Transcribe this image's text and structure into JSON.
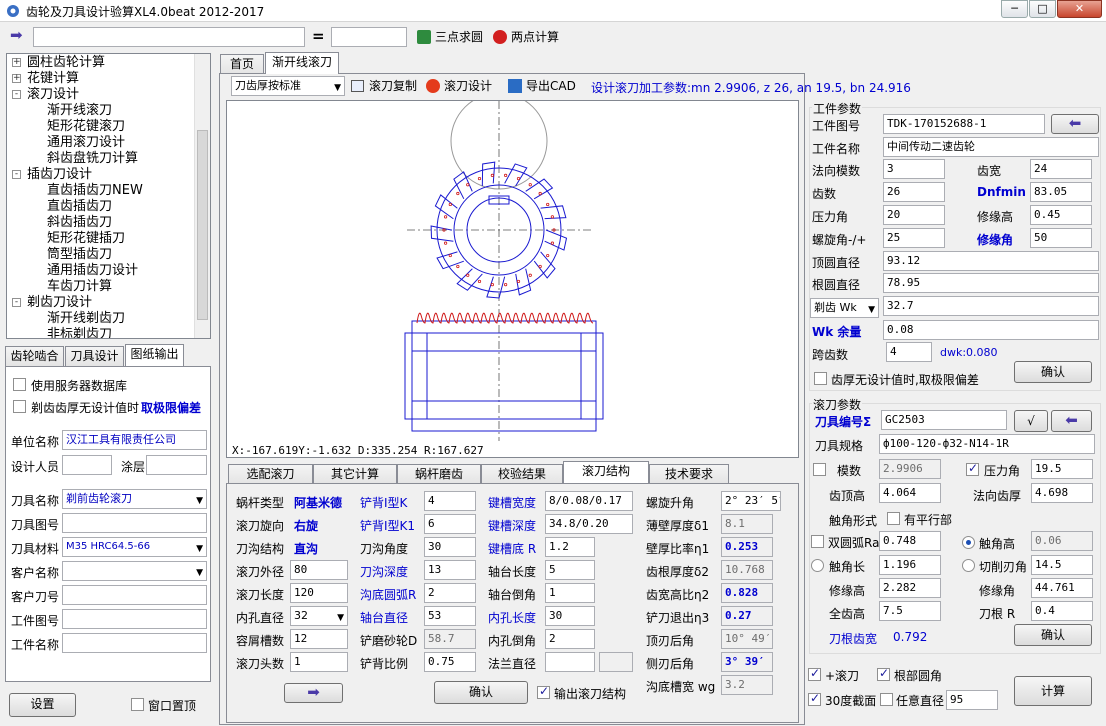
{
  "window": {
    "title": "齿轮及刀具设计验算XL4.0beat  2012-2017",
    "min": "─",
    "max": "□",
    "close": "✕"
  },
  "toolbar": {
    "input_value": "",
    "equals": "=",
    "result_value": "",
    "three_point": "三点求圆",
    "two_point": "两点计算"
  },
  "tree": {
    "items": [
      {
        "label": "圆柱齿轮计算",
        "level": 0,
        "pm": "+"
      },
      {
        "label": "花键计算",
        "level": 0,
        "pm": "+"
      },
      {
        "label": "滚刀设计",
        "level": 0,
        "pm": "-"
      },
      {
        "label": "渐开线滚刀",
        "level": 1
      },
      {
        "label": "矩形花键滚刀",
        "level": 1
      },
      {
        "label": "通用滚刀设计",
        "level": 1
      },
      {
        "label": "斜齿盘铣刀计算",
        "level": 1
      },
      {
        "label": "插齿刀设计",
        "level": 0,
        "pm": "-"
      },
      {
        "label": "直齿插齿刀NEW",
        "level": 1
      },
      {
        "label": "直齿插齿刀",
        "level": 1
      },
      {
        "label": "斜齿插齿刀",
        "level": 1
      },
      {
        "label": "矩形花键插刀",
        "level": 1
      },
      {
        "label": "筒型插齿刀",
        "level": 1
      },
      {
        "label": "通用插齿刀设计",
        "level": 1
      },
      {
        "label": "车齿刀计算",
        "level": 1
      },
      {
        "label": "剃齿刀设计",
        "level": 0,
        "pm": "-"
      },
      {
        "label": "渐开线剃齿刀",
        "level": 1
      },
      {
        "label": "非标剃齿刀",
        "level": 1
      }
    ]
  },
  "left_tabs": [
    "齿轮啮合",
    "刀具设计",
    "图纸输出"
  ],
  "left": {
    "use_server": "使用服务器数据库",
    "shave_no_design": "剃齿齿厚无设计值时",
    "limit_dev": "取极限偏差",
    "company_label": "单位名称",
    "company": "汉江工具有限责任公司",
    "designer_label": "设计人员",
    "designer": "",
    "coating_label": "涂层",
    "coating": "",
    "tool_name_label": "刀具名称",
    "tool_name": "剃前齿轮滚刀",
    "tool_drawing_label": "刀具图号",
    "tool_drawing": "",
    "material_label": "刀具材料",
    "material": "M35        HRC64.5-66",
    "customer_label": "客户名称",
    "customer": "",
    "customer_no_label": "客户刀号",
    "customer_no": "",
    "work_drawing_label": "工件图号",
    "work_drawing": "",
    "work_name_label": "工件名称",
    "work_name": "",
    "settings": "设置",
    "window_top": "窗口置顶"
  },
  "main_tabs": [
    "首页",
    "渐开线滚刀"
  ],
  "main_toolbar": {
    "mode": "刀齿厚按标准",
    "copy": "滚刀复制",
    "design": "滚刀设计",
    "export": "导出CAD",
    "params": "设计滚刀加工参数:mn 2.9906, z 26, an 19.5, bn 24.916"
  },
  "canvas": {
    "status": "X:-167.619Y:-1.632  D:335.254 R:167.627"
  },
  "workpiece": {
    "title": "工件参数",
    "drawing_no_label": "工件图号",
    "drawing_no": "TDK-170152688-1",
    "name_label": "工件名称",
    "name": "中间传动二速齿轮",
    "mn_label": "法向模数",
    "mn": "3",
    "width_label": "齿宽",
    "width": "24",
    "z_label": "齿数",
    "z": "26",
    "dnfmin_label": "Dnfmin",
    "dnfmin": "83.05",
    "alpha_label": "压力角",
    "alpha": "20",
    "edge_h_label": "修缘高",
    "edge_h": "0.45",
    "beta_label": "螺旋角-/+",
    "beta": "25",
    "edge_a_label": "修缘角",
    "edge_a": "50",
    "tip_d_label": "顶圆直径",
    "tip_d": "93.12",
    "root_d_label": "根圆直径",
    "root_d": "78.95",
    "wk_select": "剃齿 Wk",
    "wk": "32.7",
    "wk_margin_label": "Wk 余量",
    "wk_margin": "0.08",
    "span_label": "跨齿数",
    "span": "4",
    "dwk": "dwk:0.080",
    "no_design_label": "齿厚无设计值时,取极限偏差",
    "confirm": "确认"
  },
  "hob": {
    "title": "滚刀参数",
    "code_label": "刀具编号Σ",
    "code": "GC2503",
    "check": "√",
    "spec_label": "刀具规格",
    "spec": "ф100-120-ф32-N14-1R",
    "mod_label": "模数",
    "mod": "2.9906",
    "pa_label": "压力角",
    "pa": "19.5",
    "tip_h_label": "齿顶高",
    "tip_h": "4.064",
    "ntt_label": "法向齿厚",
    "ntt": "4.698",
    "contact_form_label": "触角形式",
    "parallel_label": "有平行部",
    "double_arc_label": "双圆弧Ra",
    "double_arc": "0.748",
    "contact_h_label": "触角高",
    "contact_h": "0.06",
    "contact_len_label": "触角长",
    "contact_len": "1.196",
    "undercut_label": "切削刃角",
    "undercut": "14.5",
    "edge_hh_label": "修缘高",
    "edge_hh": "2.282",
    "edge_aa_label": "修缘角",
    "edge_aa": "44.761",
    "full_h_label": "全齿高",
    "full_h": "7.5",
    "root_r_label": "刀根 R",
    "root_r": "0.4",
    "root_w_label": "刀根齿宽",
    "root_w": "0.792",
    "confirm": "确认"
  },
  "bottom_opts": {
    "plus_hob": "+滚刀",
    "root_round": "根部圆角",
    "sect30": "30度截面",
    "any_dia": "任意直径",
    "any_dia_val": "95",
    "calc": "计算"
  },
  "struct_tabs": [
    "选配滚刀",
    "其它计算",
    "蜗杆磨齿",
    "校验结果",
    "滚刀结构",
    "技术要求"
  ],
  "struct": {
    "worm_type_label": "蜗杆类型",
    "worm_type": "阿基米德",
    "rot_label": "滚刀旋向",
    "rot": "右旋",
    "groove_label": "刀沟结构",
    "groove": "直沟",
    "od_label": "滚刀外径",
    "od": "80",
    "len_label": "滚刀长度",
    "len": "120",
    "bore_label": "内孔直径",
    "bore": "32",
    "chip_label": "容屑槽数",
    "chip": "12",
    "starts_label": "滚刀头数",
    "starts": "1",
    "k_label": "铲背Ⅰ型K",
    "k": "4",
    "k1_label": "铲背Ⅰ型K1",
    "k1": "6",
    "gangle_label": "刀沟角度",
    "gangle": "30",
    "gdepth_label": "刀沟深度",
    "gdepth": "13",
    "groot_label": "沟底圆弧R",
    "groot": "2",
    "hub_label": "轴台直径",
    "hub": "53",
    "wheel_label": "铲磨砂轮D",
    "wheel": "58.7",
    "ratio_label": "铲背比例",
    "ratio": "0.75",
    "kw_label": "键槽宽度",
    "kw": "8/0.08/0.17",
    "kd_label": "键槽深度",
    "kd": "34.8/0.20",
    "kr_label": "键槽底 R",
    "kr": "1.2",
    "hublen_label": "轴台长度",
    "hublen": "5",
    "hubch_label": "轴台倒角",
    "hubch": "1",
    "borelen_label": "内孔长度",
    "borelen": "30",
    "borech_label": "内孔倒角",
    "borech": "2",
    "flange_label": "法兰直径",
    "flange": "",
    "lead_label": "螺旋升角",
    "lead": "2° 23′ 5″",
    "thin_label": "薄壁厚度δ1",
    "thin": "8.1",
    "wr_label": "壁厚比率η1",
    "wr": "0.253",
    "rt_label": "齿根厚度δ2",
    "rt": "10.768",
    "wr2_label": "齿宽高比η2",
    "wr2": "0.828",
    "rel_label": "铲刀退出η3",
    "rel": "0.27",
    "top_label": "顶刃后角",
    "top": "10° 49′",
    "side_label": "侧刃后角",
    "side": "3° 39′",
    "gw_label": "沟底槽宽 wg",
    "gw": "3.2",
    "confirm": "确认",
    "output": "输出滚刀结构"
  }
}
